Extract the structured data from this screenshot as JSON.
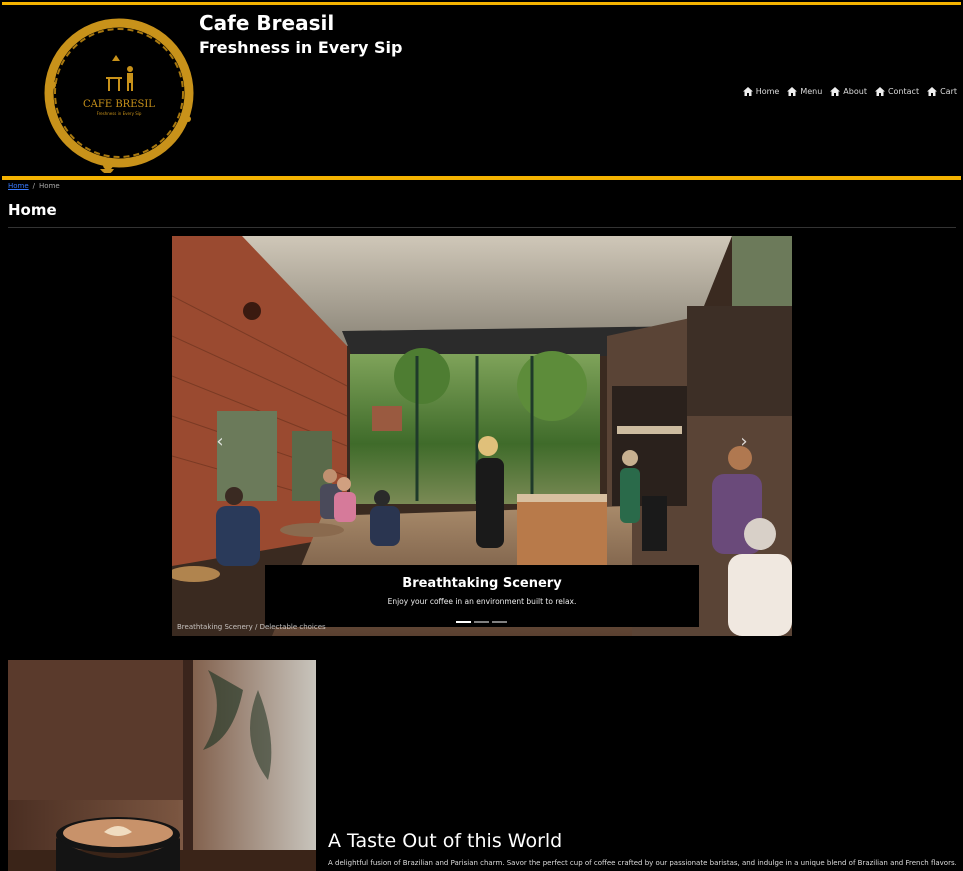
{
  "brand": {
    "title": "Cafe Breasil",
    "subtitle": "Freshness in Every Sip",
    "logo_text": "CAFE BRESIL",
    "logo_tagline": "Freshness in Every Sip",
    "accent": "#f5b301",
    "logo_gold": "#c8921a"
  },
  "nav": {
    "items": [
      {
        "label": "Home",
        "icon": "home-icon"
      },
      {
        "label": "Menu",
        "icon": "home-icon"
      },
      {
        "label": "About",
        "icon": "home-icon"
      },
      {
        "label": "Contact",
        "icon": "home-icon"
      },
      {
        "label": "Cart",
        "icon": "home-icon"
      }
    ]
  },
  "breadcrumb": {
    "link": "Home",
    "separator": "/",
    "current": "Home"
  },
  "page": {
    "title": "Home"
  },
  "carousel": {
    "caption_title": "Breathtaking Scenery",
    "caption_text": "Enjoy your coffee in an environment built to relax.",
    "slide_labels": "Breathtaking Scenery / Delectable choices",
    "indicator_count": 3,
    "active_index": 0,
    "prev_icon": "chevron-left-icon",
    "next_icon": "chevron-right-icon"
  },
  "feature": {
    "title": "A Taste Out of this World",
    "text": "A delightful fusion of Brazilian and Parisian charm. Savor the perfect cup of coffee crafted by our passionate baristas, and indulge in a unique blend of Brazilian and French flavors."
  }
}
